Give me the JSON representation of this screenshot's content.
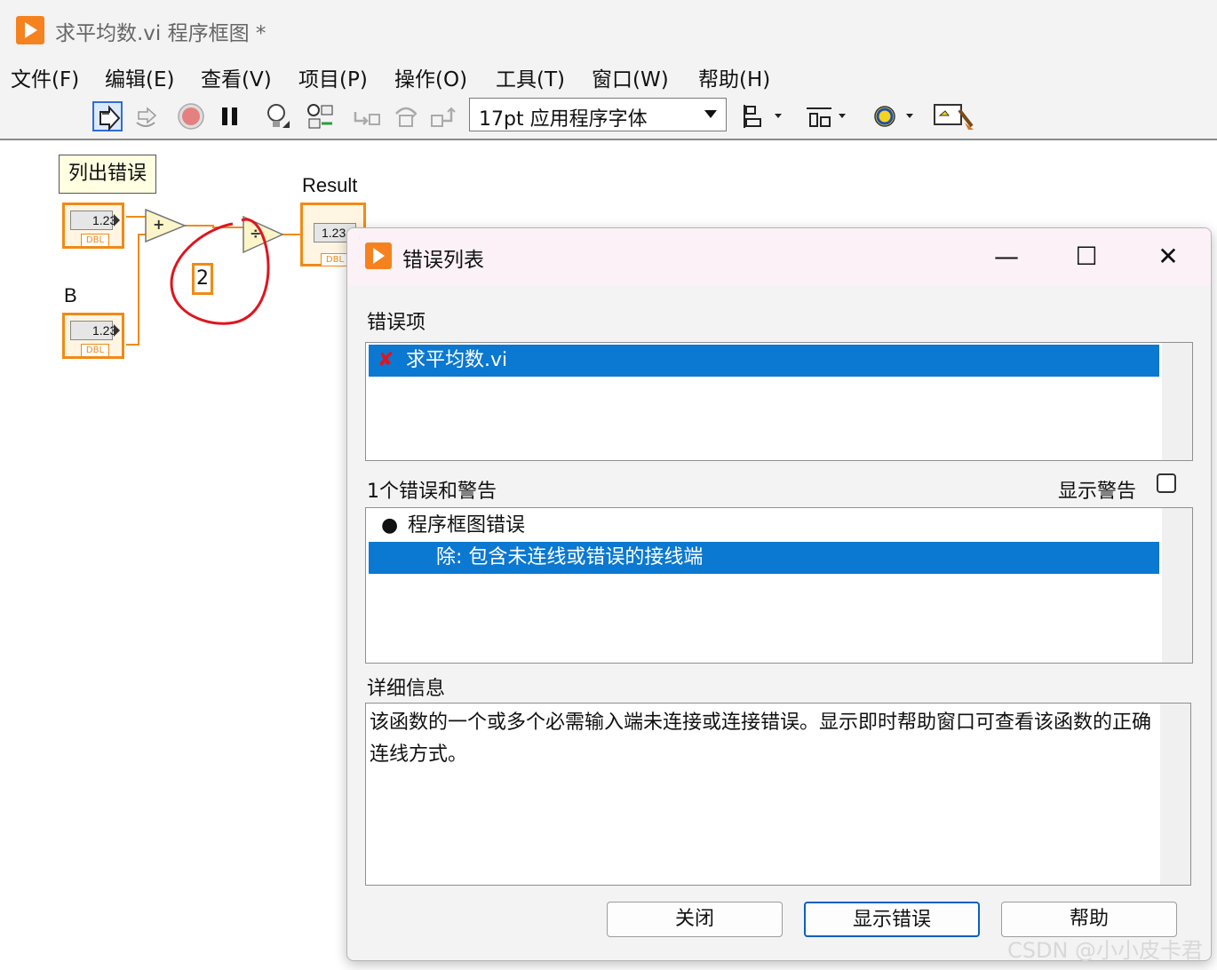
{
  "window": {
    "title": "求平均数.vi 程序框图 *"
  },
  "menu": [
    "文件(F)",
    "编辑(E)",
    "查看(V)",
    "项目(P)",
    "操作(O)",
    "工具(T)",
    "窗口(W)",
    "帮助(H)"
  ],
  "toolbar": {
    "font_select": "17pt 应用程序字体",
    "icons": [
      "run-arrow-icon",
      "run-continuously-icon",
      "abort-icon",
      "pause-icon",
      "highlight-execution-icon",
      "retain-wire-values-icon",
      "step-into-icon",
      "step-over-icon",
      "step-out-icon",
      "align-objects-icon",
      "distribute-objects-icon",
      "reorder-icon",
      "clean-up-diagram-icon"
    ]
  },
  "diagram": {
    "tooltip": "列出错误",
    "label_b": "B",
    "label_result": "Result",
    "terminal_value": "1.23",
    "terminal_type": "DBL",
    "add_symbol": "+",
    "divide_symbol": "÷",
    "constant": "2",
    "accent_color": "#f08a16",
    "annotation_color": "#e0141e"
  },
  "dialog": {
    "title": "错误列表",
    "controls": {
      "minimize": "—",
      "maximize": "☐",
      "close": "✕"
    },
    "error_items_label": "错误项",
    "error_items": [
      {
        "icon": "error-x-icon",
        "text": "求平均数.vi",
        "selected": true
      }
    ],
    "count_label": "1个错误和警告",
    "show_warnings_label": "显示警告",
    "show_warnings_checked": false,
    "errors": [
      {
        "bullet": "●",
        "text": "程序框图错误",
        "selected": false
      },
      {
        "text": "除: 包含未连线或错误的接线端",
        "selected": true
      }
    ],
    "details_label": "详细信息",
    "details_text": "该函数的一个或多个必需输入端未连接或连接错误。显示即时帮助窗口可查看该函数的正确连线方式。",
    "buttons": {
      "close": "关闭",
      "show_error": "显示错误",
      "help": "帮助"
    }
  },
  "watermark": "CSDN @小小皮卡君"
}
